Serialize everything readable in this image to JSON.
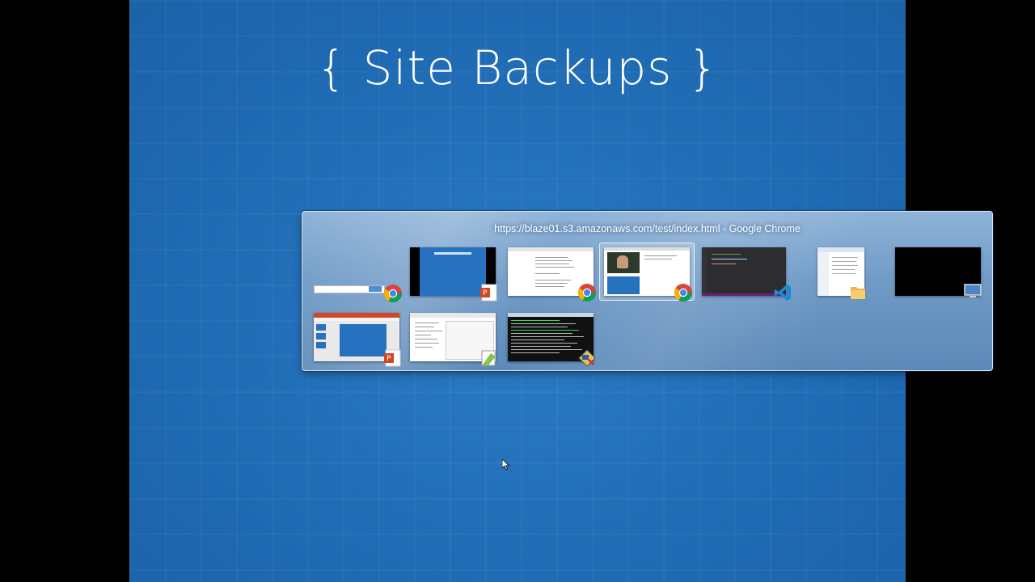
{
  "slide": {
    "title": "{ Site Backups }"
  },
  "switcher": {
    "window_title": "https://blaze01.s3.amazonaws.com/test/index.html - Google Chrome",
    "windows": [
      {
        "app": "chrome-icon",
        "selected": false
      },
      {
        "app": "powerpoint-icon",
        "selected": false
      },
      {
        "app": "chrome-icon",
        "selected": false
      },
      {
        "app": "chrome-icon",
        "selected": true
      },
      {
        "app": "vscode-icon",
        "selected": false
      },
      {
        "app": "folder-icon",
        "selected": false
      },
      {
        "app": "remote-desktop-icon",
        "selected": false
      },
      {
        "app": "powerpoint-icon",
        "selected": false
      },
      {
        "app": "notepad-plus-plus-icon",
        "selected": false
      },
      {
        "app": "putty-icon",
        "selected": false
      }
    ]
  },
  "colors": {
    "slide_bg": "#1f6bb4",
    "switcher_bg": "#6f9ac6",
    "black_bar": "#000000"
  }
}
